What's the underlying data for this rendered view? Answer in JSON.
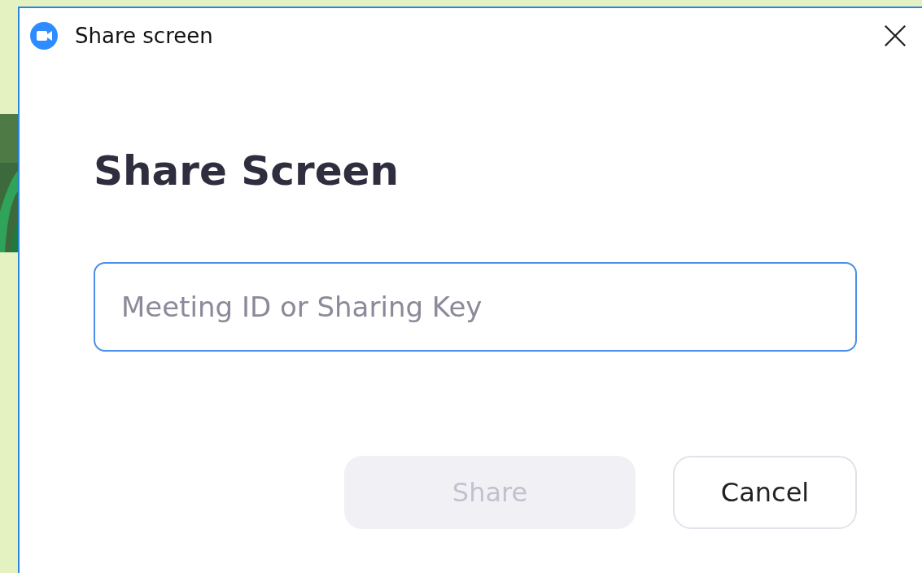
{
  "window": {
    "title": "Share screen"
  },
  "heading": "Share Screen",
  "field": {
    "placeholder": "Meeting ID or Sharing Key"
  },
  "buttons": [
    {
      "label": "Share",
      "kind": "primary",
      "disabled": true
    },
    {
      "label": "Cancel",
      "kind": "secondary",
      "disabled": false
    }
  ]
}
